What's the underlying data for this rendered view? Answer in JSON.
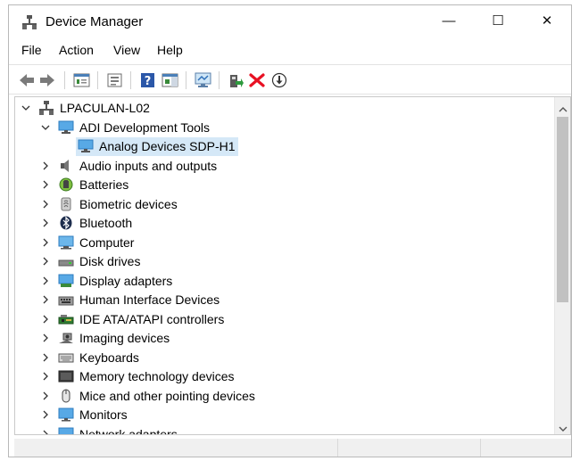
{
  "window": {
    "title": "Device Manager",
    "icon": "device-manager-icon",
    "caption_buttons": {
      "minimize": "—",
      "maximize": "☐",
      "close": "✕"
    }
  },
  "menu": {
    "items": [
      "File",
      "Action",
      "View",
      "Help"
    ]
  },
  "toolbar": {
    "icons": [
      "back-arrow-icon",
      "forward-arrow-icon",
      "properties-icon",
      "show-hidden-icon",
      "help-icon",
      "action-pane-icon",
      "scan-hardware-icon",
      "update-driver-icon",
      "uninstall-device-icon",
      "disable-device-icon"
    ]
  },
  "tree": {
    "root": {
      "label": "LPACULAN-L02",
      "expanded": true,
      "icon": "computer-network-icon"
    },
    "nodes": [
      {
        "label": "ADI Development Tools",
        "level": 1,
        "expanded": true,
        "icon": "monitor-icon"
      },
      {
        "label": "Analog Devices SDP-H1",
        "level": 2,
        "selected": true,
        "icon": "monitor-icon"
      },
      {
        "label": "Audio inputs and outputs",
        "level": 1,
        "expanded": false,
        "icon": "speaker-icon"
      },
      {
        "label": "Batteries",
        "level": 1,
        "expanded": false,
        "icon": "battery-icon"
      },
      {
        "label": "Biometric devices",
        "level": 1,
        "expanded": false,
        "icon": "fingerprint-icon"
      },
      {
        "label": "Bluetooth",
        "level": 1,
        "expanded": false,
        "icon": "bluetooth-icon"
      },
      {
        "label": "Computer",
        "level": 1,
        "expanded": false,
        "icon": "computer-icon"
      },
      {
        "label": "Disk drives",
        "level": 1,
        "expanded": false,
        "icon": "disk-drive-icon"
      },
      {
        "label": "Display adapters",
        "level": 1,
        "expanded": false,
        "icon": "display-adapter-icon"
      },
      {
        "label": "Human Interface Devices",
        "level": 1,
        "expanded": false,
        "icon": "hid-icon"
      },
      {
        "label": "IDE ATA/ATAPI controllers",
        "level": 1,
        "expanded": false,
        "icon": "ide-controller-icon"
      },
      {
        "label": "Imaging devices",
        "level": 1,
        "expanded": false,
        "icon": "camera-icon"
      },
      {
        "label": "Keyboards",
        "level": 1,
        "expanded": false,
        "icon": "keyboard-icon"
      },
      {
        "label": "Memory technology devices",
        "level": 1,
        "expanded": false,
        "icon": "memory-card-icon"
      },
      {
        "label": "Mice and other pointing devices",
        "level": 1,
        "expanded": false,
        "icon": "mouse-icon"
      },
      {
        "label": "Monitors",
        "level": 1,
        "expanded": false,
        "icon": "monitor-icon"
      },
      {
        "label": "Network adapters",
        "level": 1,
        "expanded": false,
        "icon": "network-adapter-icon"
      }
    ]
  },
  "colors": {
    "selection": "#d5e8f7",
    "accent": "#1a8ad4",
    "delete_red": "#e81123"
  }
}
